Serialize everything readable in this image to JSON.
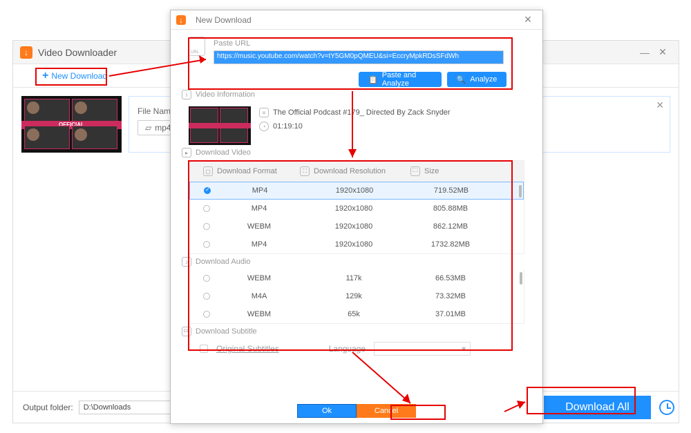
{
  "main": {
    "title": "Video Downloader",
    "new_download": "New Download",
    "file_name_label": "File Name:",
    "format_chip": "mp4",
    "output_label": "Output folder:",
    "output_path": "D:\\Downloads",
    "download_all": "Download All"
  },
  "thumb": {
    "label": "OFFICIAL"
  },
  "dialog": {
    "title": "New Download",
    "paste_label": "Paste URL",
    "url_value": "https://music.youtube.com/watch?v=tY5GM0pQMEU&si=EccryMpkRDsSFdWh",
    "paste_analyze": "Paste and Analyze",
    "analyze": "Analyze",
    "video_info_label": "Video Information",
    "video_title": "The Official Podcast #179_ Directed By Zack Snyder",
    "duration": "01:19:10",
    "download_video_label": "Download Video",
    "headers": {
      "format": "Download Format",
      "resolution": "Download Resolution",
      "size": "Size"
    },
    "video_rows": [
      {
        "format": "MP4",
        "res": "1920x1080",
        "size": "719.52MB",
        "selected": true
      },
      {
        "format": "MP4",
        "res": "1920x1080",
        "size": "805.88MB",
        "selected": false
      },
      {
        "format": "WEBM",
        "res": "1920x1080",
        "size": "862.12MB",
        "selected": false
      },
      {
        "format": "MP4",
        "res": "1920x1080",
        "size": "1732.82MB",
        "selected": false
      }
    ],
    "download_audio_label": "Download Audio",
    "audio_rows": [
      {
        "format": "WEBM",
        "res": "117k",
        "size": "66.53MB"
      },
      {
        "format": "M4A",
        "res": "129k",
        "size": "73.32MB"
      },
      {
        "format": "WEBM",
        "res": "65k",
        "size": "37.01MB"
      }
    ],
    "subtitle_label": "Download Subtitle",
    "orig_sub": "Original Subtitles",
    "language_label": "Language",
    "ok": "Ok",
    "cancel": "Cancel"
  }
}
